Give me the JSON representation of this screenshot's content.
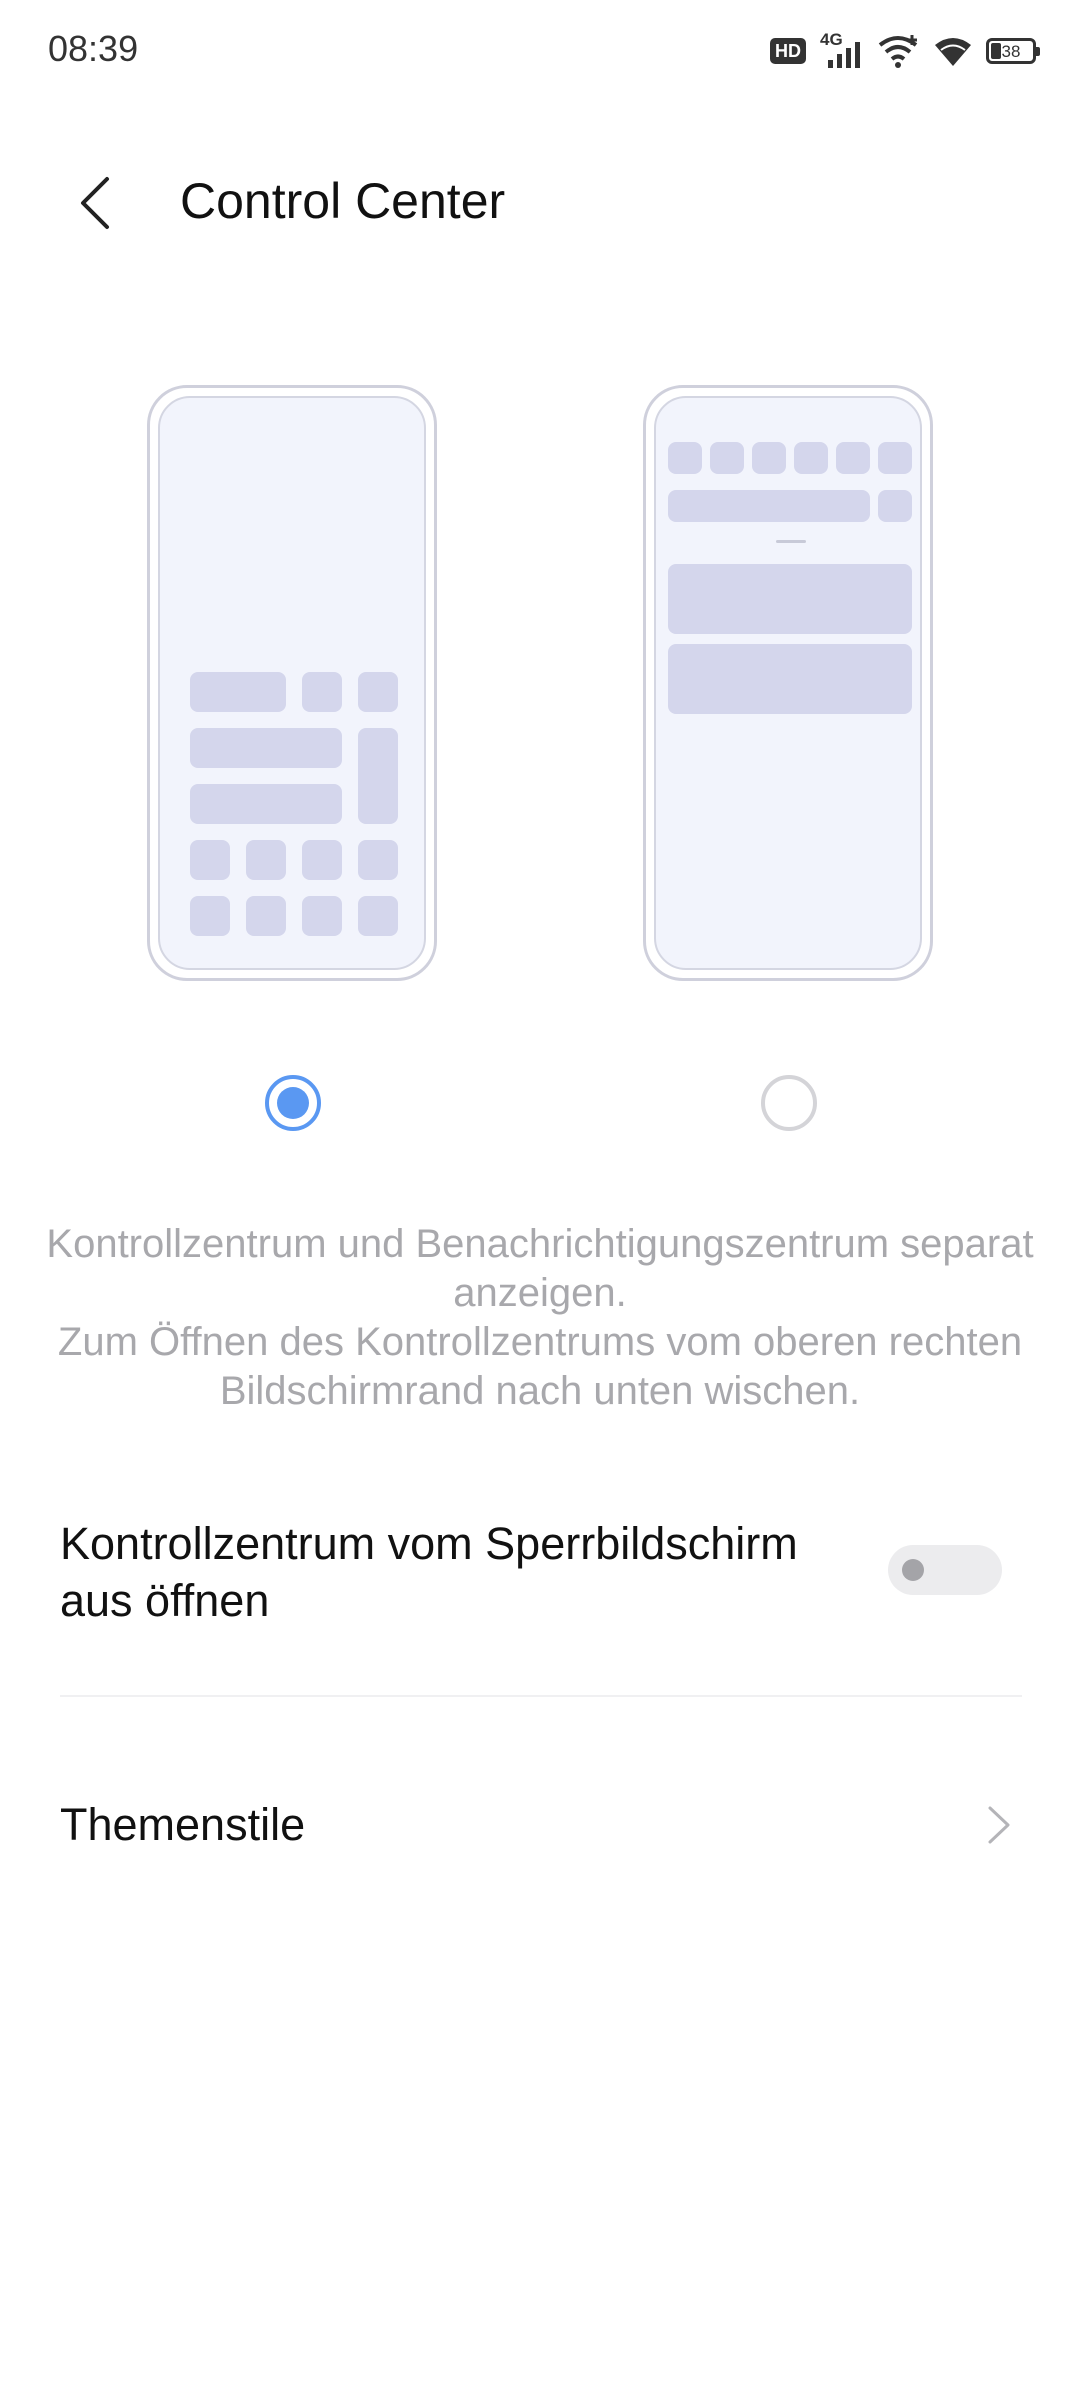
{
  "status_bar": {
    "time": "08:39",
    "hd_badge": "HD",
    "network": "4G",
    "battery_level": "38",
    "icons": [
      "hd-icon",
      "signal-4g-icon",
      "wifi-plus-icon",
      "wifi-icon",
      "battery-icon"
    ]
  },
  "header": {
    "title": "Control Center",
    "back_icon": "chevron-left-icon"
  },
  "layout_options": [
    {
      "name": "separate-layout",
      "selected": true
    },
    {
      "name": "combined-layout",
      "selected": false
    }
  ],
  "description": {
    "line1": "Kontrollzentrum und Benachrichtigungszentrum separat anzeigen.",
    "line2": "Zum Öffnen des Kontrollzentrums vom oberen rechten Bildschirmrand nach unten wischen."
  },
  "settings": {
    "lock_screen_label": "Kontrollzentrum vom Sperrbildschirm aus öffnen",
    "lock_screen_enabled": false,
    "theme_label": "Themenstile",
    "theme_icon": "chevron-right-icon"
  },
  "colors": {
    "accent": "#5a98f2",
    "tile": "#d4d6ec",
    "description_text": "#a8a8ac"
  }
}
